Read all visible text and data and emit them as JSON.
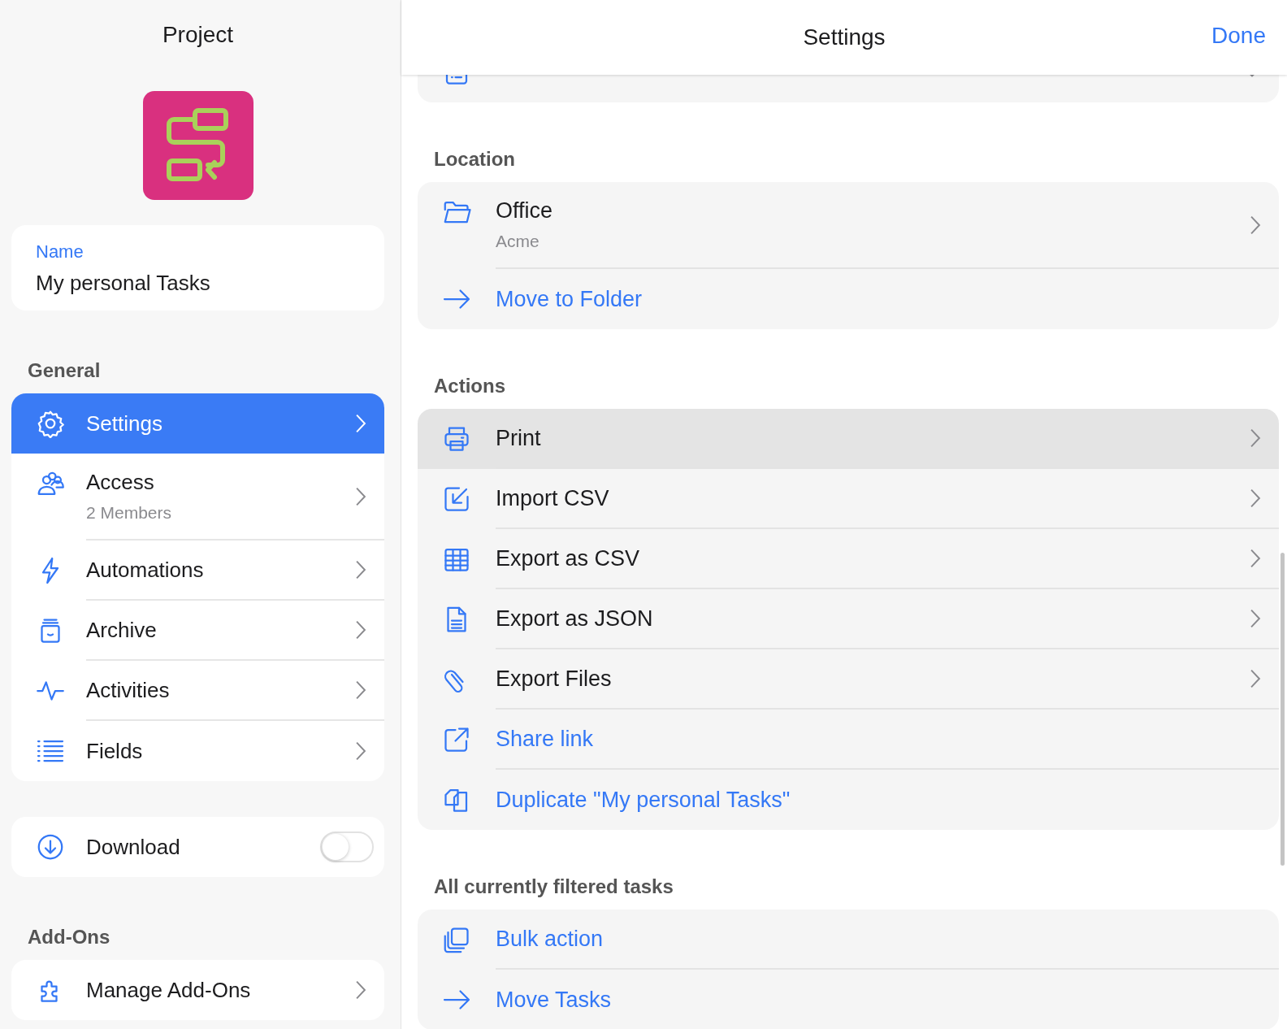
{
  "left": {
    "title": "Project",
    "name_field": {
      "label": "Name",
      "value": "My personal Tasks"
    },
    "general": {
      "heading": "General",
      "items": [
        {
          "label": "Settings",
          "selected": true
        },
        {
          "label": "Access",
          "subtitle": "2 Members",
          "selected": false
        },
        {
          "label": "Automations",
          "selected": false
        },
        {
          "label": "Archive",
          "selected": false
        },
        {
          "label": "Activities",
          "selected": false
        },
        {
          "label": "Fields",
          "selected": false
        }
      ]
    },
    "download": {
      "label": "Download",
      "on": false
    },
    "addons": {
      "heading": "Add-Ons",
      "items": [
        {
          "label": "Manage Add-Ons",
          "selected": false
        }
      ]
    }
  },
  "right": {
    "title": "Settings",
    "done": "Done",
    "sections": [
      {
        "items": [
          {
            "kind": "dropdown",
            "highlighted": false
          }
        ]
      },
      {
        "heading": "Location",
        "items": [
          {
            "kind": "nav",
            "label": "Office",
            "subtitle": "Acme",
            "highlighted": false
          },
          {
            "kind": "action",
            "label": "Move to Folder",
            "highlighted": false
          }
        ]
      },
      {
        "heading": "Actions",
        "items": [
          {
            "kind": "nav",
            "label": "Print",
            "highlighted": true
          },
          {
            "kind": "nav",
            "label": "Import CSV",
            "highlighted": false
          },
          {
            "kind": "nav",
            "label": "Export as CSV",
            "highlighted": false
          },
          {
            "kind": "nav",
            "label": "Export as JSON",
            "highlighted": false
          },
          {
            "kind": "nav",
            "label": "Export Files",
            "highlighted": false
          },
          {
            "kind": "action",
            "label": "Share link",
            "highlighted": false
          },
          {
            "kind": "action",
            "label": "Duplicate \"My personal Tasks\"",
            "highlighted": false
          }
        ]
      },
      {
        "heading": "All currently filtered tasks",
        "items": [
          {
            "kind": "action",
            "label": "Bulk action",
            "highlighted": false
          },
          {
            "kind": "action",
            "label": "Move Tasks",
            "highlighted": false
          }
        ]
      }
    ]
  }
}
